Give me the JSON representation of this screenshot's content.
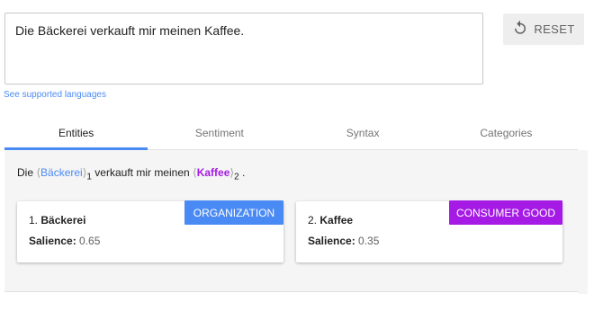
{
  "input": {
    "text": "Die Bäckerei verkauft mir meinen Kaffee."
  },
  "reset": {
    "label": "RESET"
  },
  "languages_link": "See supported languages",
  "tabs": [
    "Entities",
    "Sentiment",
    "Syntax",
    "Categories"
  ],
  "active_tab": "Entities",
  "sentence": {
    "prefix": "Die ",
    "entity1": "Bäckerei",
    "index1": "1",
    "middle": " verkauft mir meinen ",
    "entity2": "Kaffee",
    "index2": "2",
    "suffix": " .",
    "open_bracket": "⟨",
    "close_bracket": "⟩"
  },
  "entities": [
    {
      "number": "1.",
      "name": "Bäckerei",
      "salience_label": "Salience:",
      "salience": "0.65",
      "type": "ORGANIZATION",
      "color": "#4a8af4"
    },
    {
      "number": "2.",
      "name": "Kaffee",
      "salience_label": "Salience:",
      "salience": "0.35",
      "type": "CONSUMER GOOD",
      "color": "#a51ae5"
    }
  ],
  "colors": {
    "accent": "#4a8af4",
    "consumer_good": "#a51ae5"
  }
}
